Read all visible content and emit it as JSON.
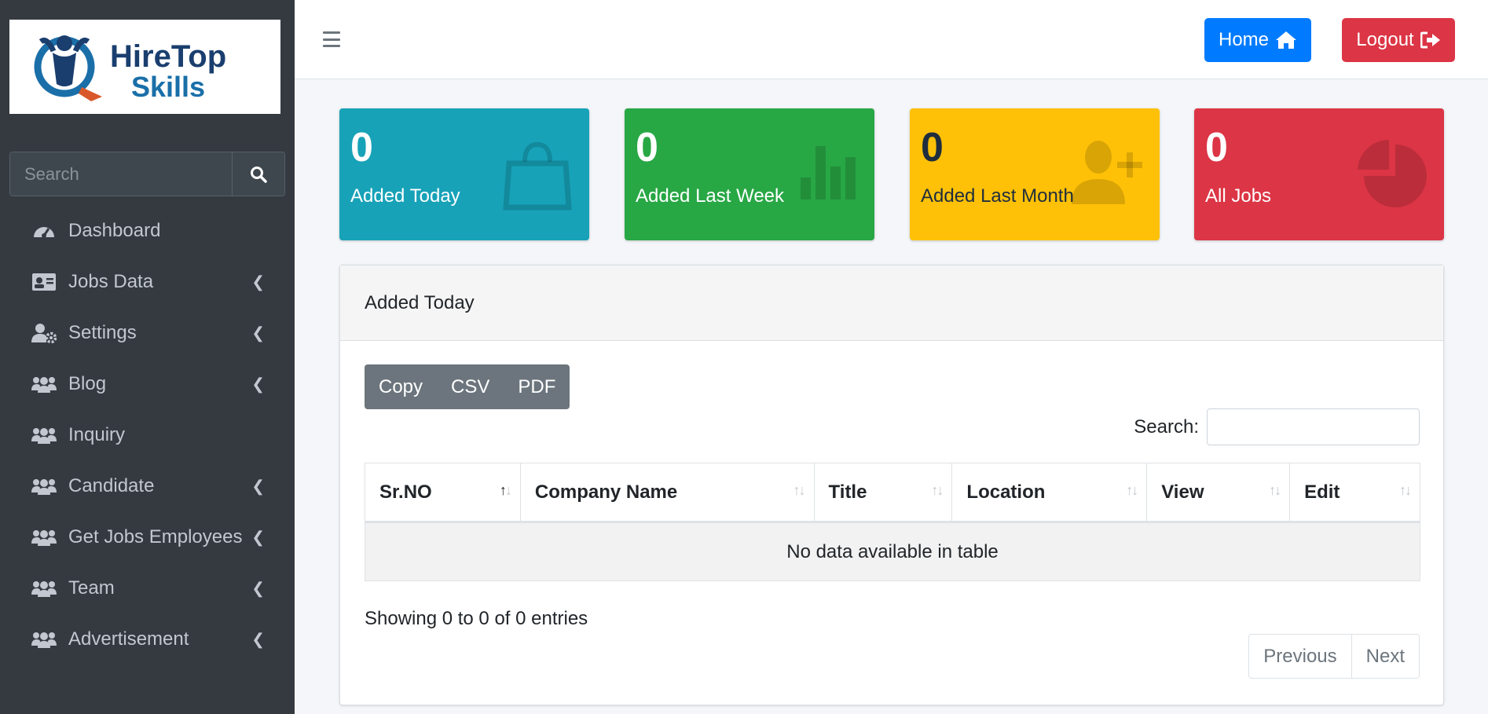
{
  "logo": {
    "line1": "HireTop",
    "line2": "Skills"
  },
  "sidebar": {
    "search_placeholder": "Search",
    "items": [
      {
        "label": "Dashboard",
        "icon": "tachometer-icon",
        "has_submenu": false
      },
      {
        "label": "Jobs Data",
        "icon": "id-card-icon",
        "has_submenu": true
      },
      {
        "label": "Settings",
        "icon": "user-cog-icon",
        "has_submenu": true
      },
      {
        "label": "Blog",
        "icon": "users-icon",
        "has_submenu": true
      },
      {
        "label": "Inquiry",
        "icon": "users-icon",
        "has_submenu": false
      },
      {
        "label": "Candidate",
        "icon": "users-icon",
        "has_submenu": true
      },
      {
        "label": "Get Jobs Employees",
        "icon": "users-icon",
        "has_submenu": true
      },
      {
        "label": "Team",
        "icon": "users-icon",
        "has_submenu": true
      },
      {
        "label": "Advertisement",
        "icon": "users-icon",
        "has_submenu": true
      }
    ]
  },
  "topbar": {
    "home_label": "Home",
    "logout_label": "Logout"
  },
  "stats": [
    {
      "value": "0",
      "label": "Added Today",
      "icon": "shopping-bag-icon",
      "color": "#17a2b8"
    },
    {
      "value": "0",
      "label": "Added Last Week",
      "icon": "bar-chart-icon",
      "color": "#28a745"
    },
    {
      "value": "0",
      "label": "Added Last Month",
      "icon": "user-plus-icon",
      "color": "#ffc107"
    },
    {
      "value": "0",
      "label": "All Jobs",
      "icon": "pie-chart-icon",
      "color": "#dc3545"
    }
  ],
  "card": {
    "title": "Added Today",
    "buttons": [
      "Copy",
      "CSV",
      "PDF"
    ],
    "search_label": "Search:",
    "columns": [
      "Sr.NO",
      "Company Name",
      "Title",
      "Location",
      "View",
      "Edit"
    ],
    "empty_message": "No data available in table",
    "info": "Showing 0 to 0 of 0 entries",
    "pager": {
      "previous": "Previous",
      "next": "Next"
    }
  }
}
